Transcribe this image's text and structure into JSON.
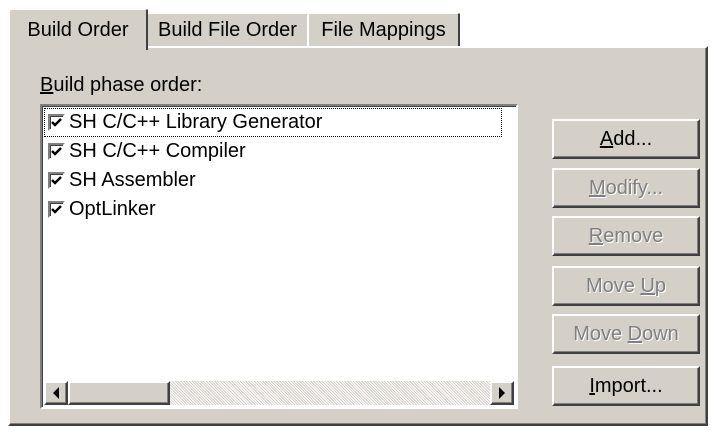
{
  "tabs": [
    {
      "label": "Build Order",
      "active": true
    },
    {
      "label": "Build File Order",
      "active": false
    },
    {
      "label": "File Mappings",
      "active": false
    }
  ],
  "build_phase": {
    "caption_mnemonic": "B",
    "caption_rest": "uild phase order:",
    "items": [
      {
        "label": "SH C/C++ Library Generator",
        "checked": true
      },
      {
        "label": "SH C/C++ Compiler",
        "checked": true
      },
      {
        "label": "SH Assembler",
        "checked": true
      },
      {
        "label": "OptLinker",
        "checked": true
      }
    ]
  },
  "buttons": {
    "add": {
      "mnemonic": "A",
      "rest": "dd...",
      "enabled": true
    },
    "modify": {
      "mnemonic": "M",
      "rest": "odify...",
      "enabled": false
    },
    "remove": {
      "mnemonic": "R",
      "rest": "emove",
      "enabled": false
    },
    "move_up": {
      "pre": "Move ",
      "mnemonic": "U",
      "rest": "p",
      "enabled": false
    },
    "move_down": {
      "pre": "Move ",
      "mnemonic": "D",
      "rest": "own",
      "enabled": false
    },
    "import": {
      "mnemonic": "I",
      "rest": "mport...",
      "enabled": true
    }
  },
  "icons": {
    "checkbox": "check-mark",
    "scroll_left": "left-triangle",
    "scroll_right": "right-triangle"
  },
  "colors": {
    "face": "#d4d0c8",
    "highlight": "#ffffff",
    "shadow": "#808080",
    "dark_shadow": "#404040",
    "disabled_text": "#808080"
  }
}
